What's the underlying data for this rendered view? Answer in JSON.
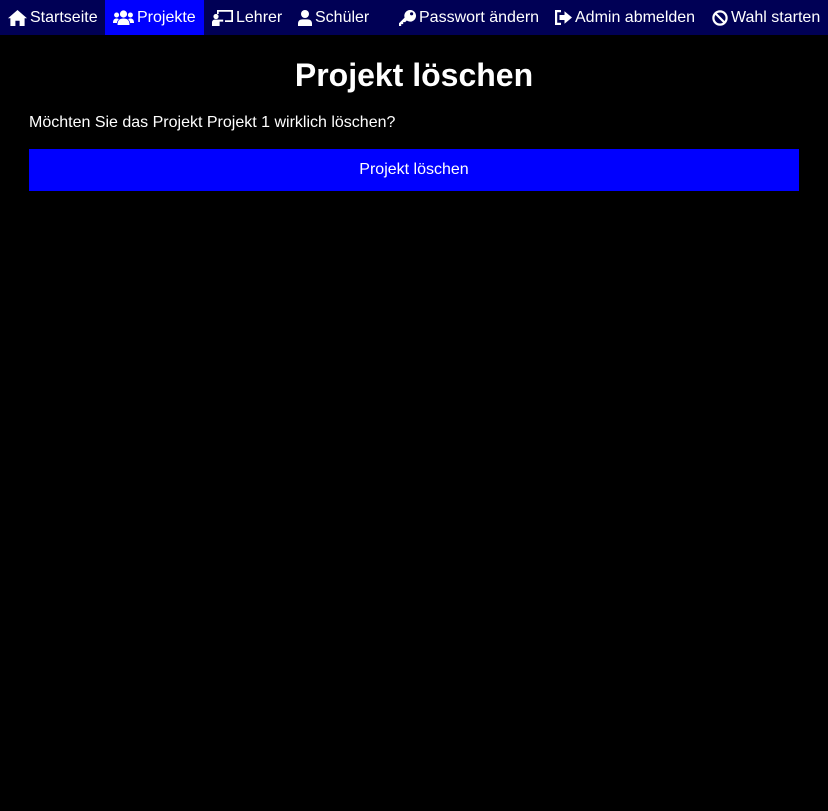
{
  "nav": {
    "items": [
      {
        "label": "Startseite",
        "icon": "home-icon",
        "active": false
      },
      {
        "label": "Projekte",
        "icon": "users-icon",
        "active": true
      },
      {
        "label": "Lehrer",
        "icon": "chalkboard-teacher-icon",
        "active": false
      },
      {
        "label": "Schüler",
        "icon": "user-icon",
        "active": false
      },
      {
        "label": "Passwort ändern",
        "icon": "key-icon",
        "active": false
      },
      {
        "label": "Admin abmelden",
        "icon": "sign-out-icon",
        "active": false
      },
      {
        "label": "Wahl starten",
        "icon": "ban-icon",
        "active": false
      }
    ]
  },
  "main": {
    "title": "Projekt löschen",
    "question": "Möchten Sie das Projekt Projekt 1 wirklich löschen?",
    "delete_button_label": "Projekt löschen"
  },
  "colors": {
    "background": "#000000",
    "nav_background": "#000055",
    "accent": "#0000ff",
    "text": "#ffffff"
  }
}
